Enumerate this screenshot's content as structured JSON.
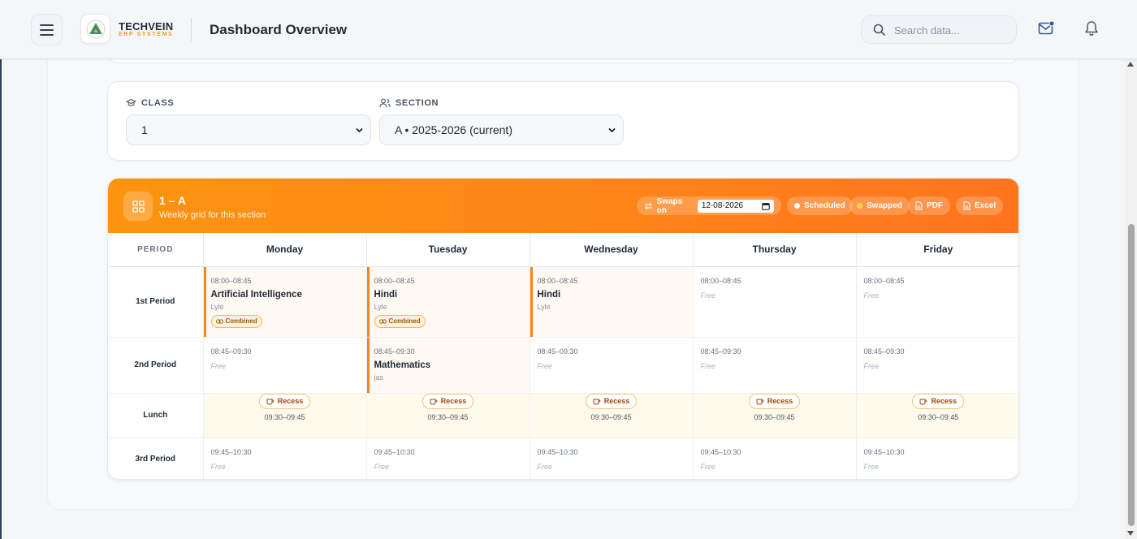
{
  "header": {
    "brand_name": "TECHVEIN",
    "brand_sub": "ERP SYSTEMS",
    "page_title": "Dashboard Overview",
    "search_placeholder": "Search data..."
  },
  "filters": {
    "class_label": "CLASS",
    "class_value": "1",
    "section_label": "SECTION",
    "section_value": "A • 2025-2026 (current)"
  },
  "timetable": {
    "title": "1 – A",
    "subtitle": "Weekly grid for this section",
    "swaps_label": "Swaps on",
    "swap_date": "12-08-2026",
    "legend_scheduled": "Scheduled",
    "legend_swapped": "Swapped",
    "pdf_label": "PDF",
    "excel_label": "Excel",
    "colors": {
      "accent": "#fd8c14",
      "busy_bar": "#f5851d",
      "scheduled_dot": "#ffffff",
      "swapped_dot": "#ffd54a"
    },
    "period_header": "PERIOD",
    "days": [
      "Monday",
      "Tuesday",
      "Wednesday",
      "Thursday",
      "Friday"
    ],
    "rows": [
      {
        "period": "1st Period",
        "cells": [
          {
            "time": "08:00–08:45",
            "subject": "Artificial Intelligence",
            "teacher": "Lyle",
            "badge": "Combined"
          },
          {
            "time": "08:00–08:45",
            "subject": "Hindi",
            "teacher": "Lyle",
            "badge": "Combined"
          },
          {
            "time": "08:00–08:45",
            "subject": "Hindi",
            "teacher": "Lyle"
          },
          {
            "time": "08:00–08:45",
            "free": "Free"
          },
          {
            "time": "08:00–08:45",
            "free": "Free"
          }
        ]
      },
      {
        "period": "2nd Period",
        "cells": [
          {
            "time": "08:45–09:30",
            "free": "Free"
          },
          {
            "time": "08:45–09:30",
            "subject": "Mathematics",
            "teacher": "jas"
          },
          {
            "time": "08:45–09:30",
            "free": "Free"
          },
          {
            "time": "08:45–09:30",
            "free": "Free"
          },
          {
            "time": "08:45–09:30",
            "free": "Free"
          }
        ]
      },
      {
        "period": "Lunch",
        "lunch": true,
        "recess_label": "Recess",
        "time": "09:30–09:45"
      },
      {
        "period": "3rd Period",
        "cells": [
          {
            "time": "09:45–10:30",
            "free": "Free"
          },
          {
            "time": "09:45–10:30",
            "free": "Free"
          },
          {
            "time": "09:45–10:30",
            "free": "Free"
          },
          {
            "time": "09:45–10:30",
            "free": "Free"
          },
          {
            "time": "09:45–10:30",
            "free": "Free"
          }
        ]
      }
    ]
  }
}
